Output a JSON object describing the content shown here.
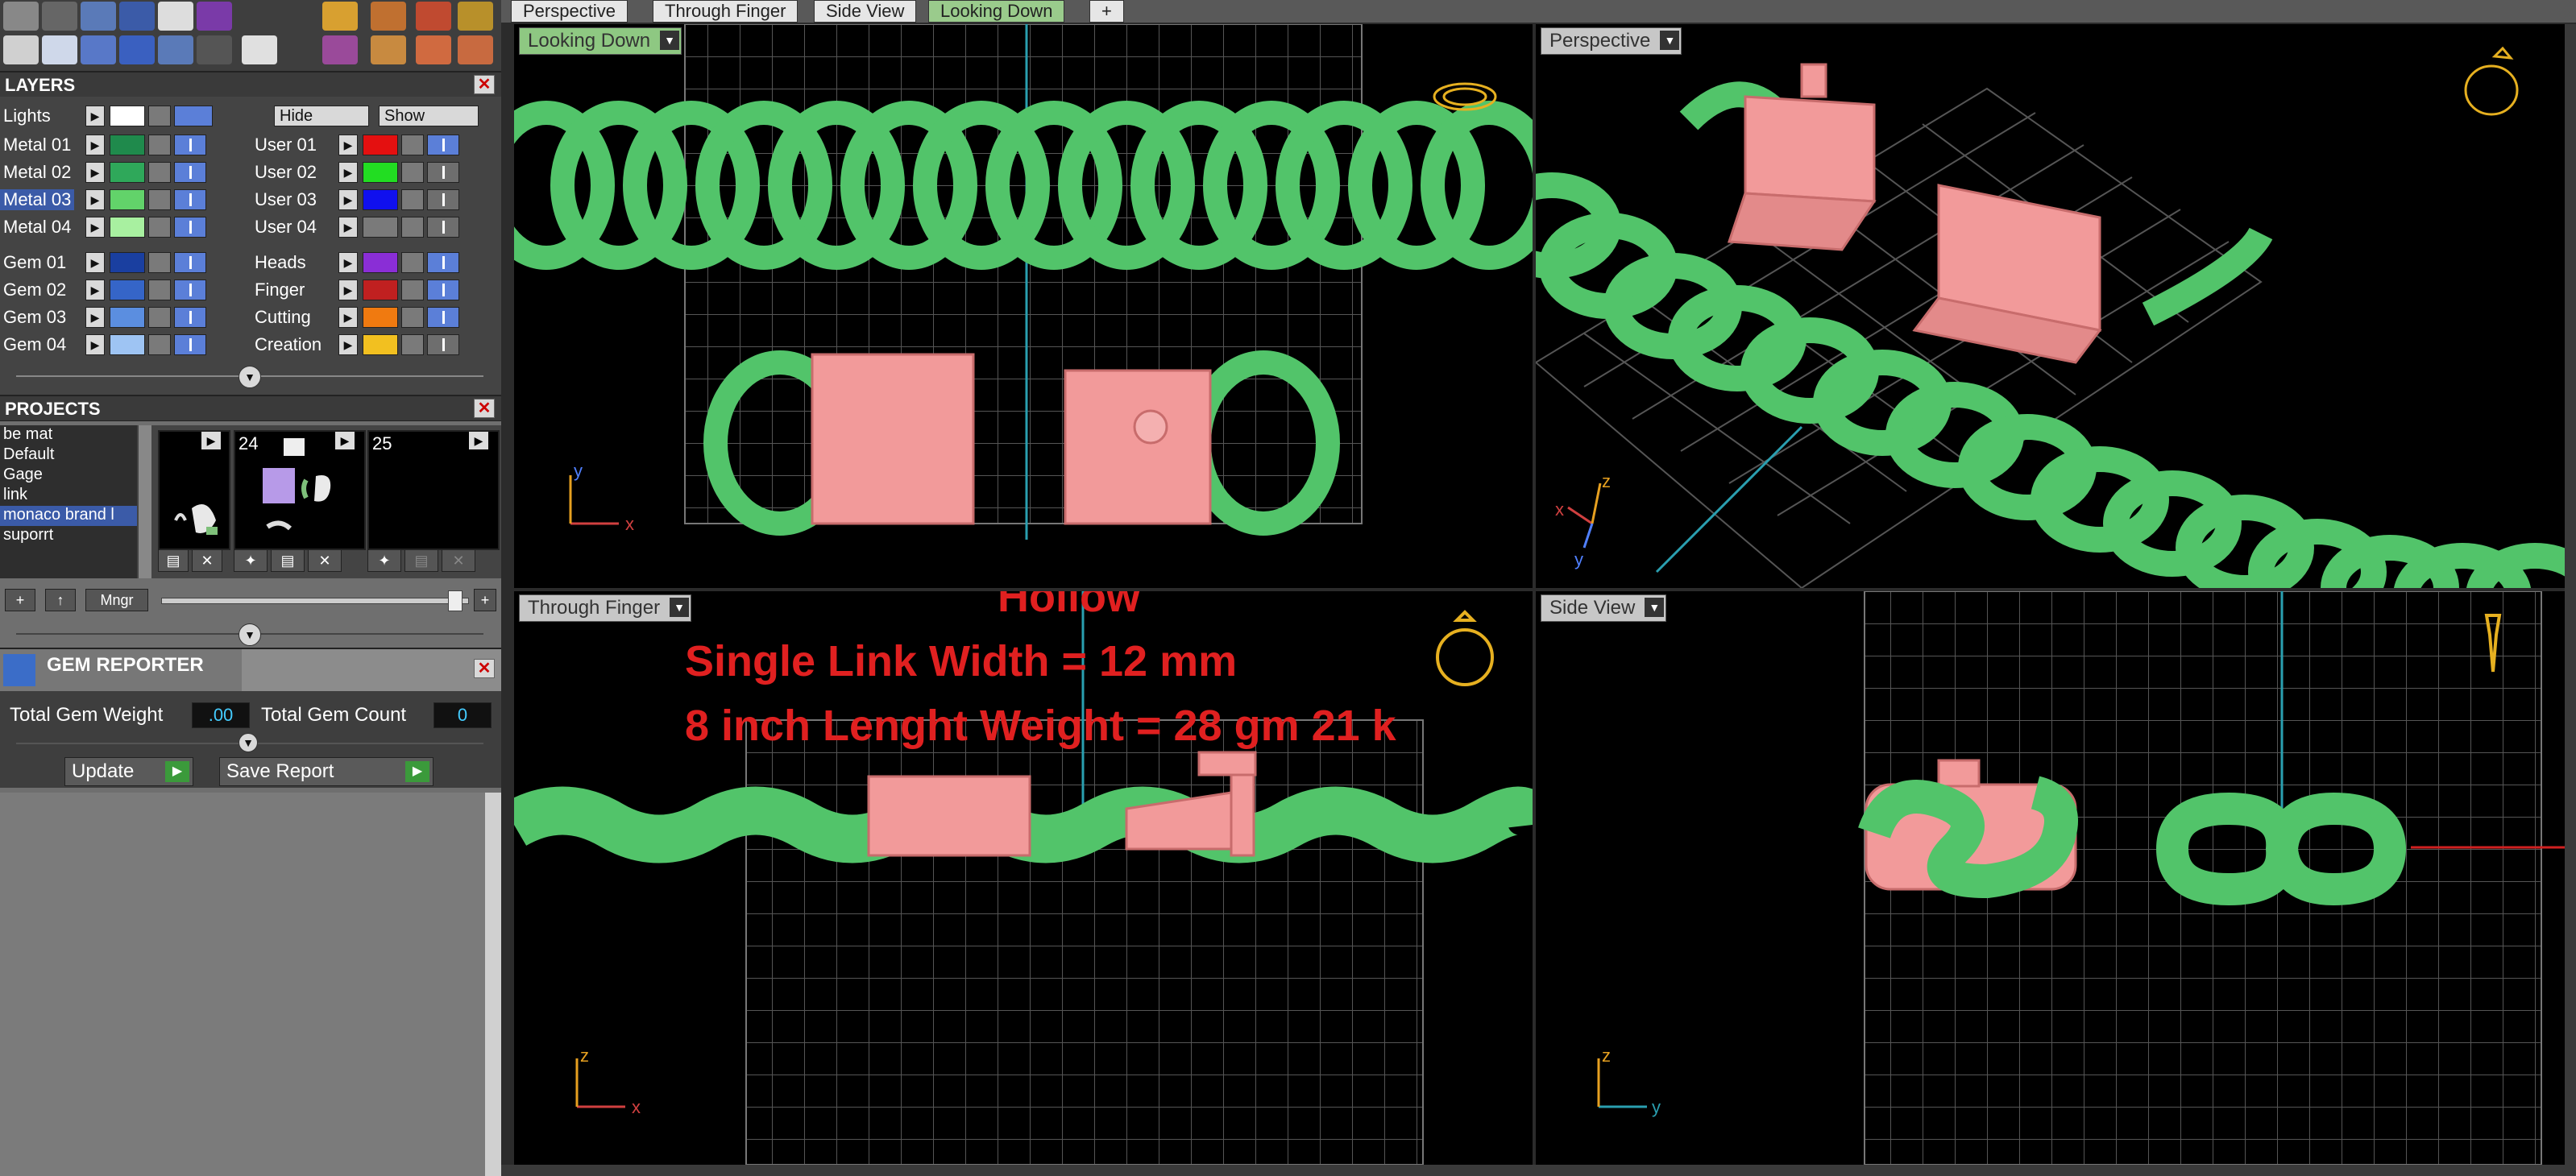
{
  "tabs": [
    "Perspective",
    "Through Finger",
    "Side View",
    "Looking Down",
    "+"
  ],
  "layers": {
    "title": "LAYERS",
    "close": "✕",
    "lights": {
      "label": "Lights",
      "color": "#ffffff"
    },
    "hide_label": "Hide",
    "show_label": "Show",
    "left_rows": [
      {
        "label": "Metal 01",
        "color": "#1f8a4c"
      },
      {
        "label": "Metal 02",
        "color": "#2fa85a"
      },
      {
        "label": "Metal 03",
        "color": "#62d36a"
      },
      {
        "label": "Metal 04",
        "color": "#a8f0a0"
      },
      {
        "label": "Gem 01",
        "color": "#1a3fa0"
      },
      {
        "label": "Gem 02",
        "color": "#3565c8"
      },
      {
        "label": "Gem 03",
        "color": "#5b8ee0"
      },
      {
        "label": "Gem 04",
        "color": "#9ec4f3"
      }
    ],
    "right_rows": [
      {
        "label": "User 01",
        "color": "#e41010"
      },
      {
        "label": "User 02",
        "color": "#22dd22"
      },
      {
        "label": "User 03",
        "color": "#1010ee"
      },
      {
        "label": "User 04",
        "color": "#7a7a7a"
      },
      {
        "label": "Heads",
        "color": "#8a2ed6"
      },
      {
        "label": "Finger",
        "color": "#c02020"
      },
      {
        "label": "Cutting",
        "color": "#f07a10"
      },
      {
        "label": "Creation",
        "color": "#f2c020"
      }
    ]
  },
  "projects": {
    "title": "PROJECTS",
    "close": "✕",
    "items": [
      "be mat",
      "Default",
      "Gage",
      "link",
      "monaco brand l",
      "suporrt"
    ],
    "selected": "monaco brand l",
    "thumb_labels": [
      "",
      "24",
      "25"
    ],
    "add": "+",
    "up": "↑",
    "manager": "Mngr"
  },
  "gem_reporter": {
    "title": "GEM REPORTER",
    "close": "✕",
    "weight_label": "Total Gem Weight",
    "weight_value": ".00",
    "count_label": "Total Gem Count",
    "count_value": "0",
    "update": "Update",
    "save": "Save Report"
  },
  "viewports": {
    "top_left": "Looking Down",
    "top_right": "Perspective",
    "bottom_left": "Through Finger",
    "bottom_right": "Side View"
  },
  "axes": {
    "x": "x",
    "y": "y",
    "z": "z"
  },
  "overlay": {
    "line1": "Hollow",
    "line2": "Single Link Width = 12 mm",
    "line3": "8 inch Lenght Weight = 28 gm 21 k"
  },
  "colors": {
    "chain": "#52c46a",
    "clasp": "#f29a9a",
    "grid": "#5a5a5a",
    "overlay_text": "#e02020"
  }
}
